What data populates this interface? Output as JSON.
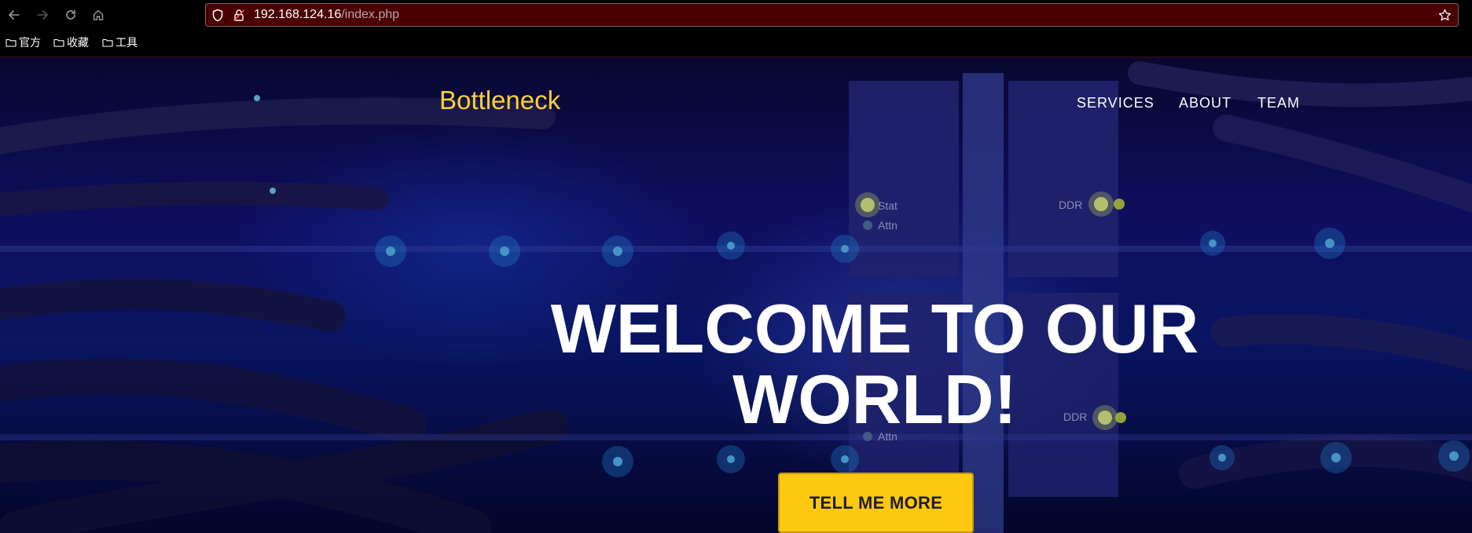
{
  "browser": {
    "url_host": "192.168.124.16",
    "url_path": "/index.php",
    "bookmarks": [
      "官方",
      "收藏",
      "工具"
    ]
  },
  "site": {
    "brand": "Bottleneck",
    "nav": [
      "SERVICES",
      "ABOUT",
      "TEAM"
    ],
    "hero_title_line1": "WELCOME TO OUR",
    "hero_title_line2": "WORLD!",
    "cta_label": "TELL ME MORE",
    "server_labels": [
      "Stat",
      "Attn",
      "DDR",
      "Attn",
      "DDR"
    ]
  },
  "colors": {
    "brand": "#fed136",
    "cta_bg": "#fec810",
    "url_bar_bg": "#4a0000"
  }
}
